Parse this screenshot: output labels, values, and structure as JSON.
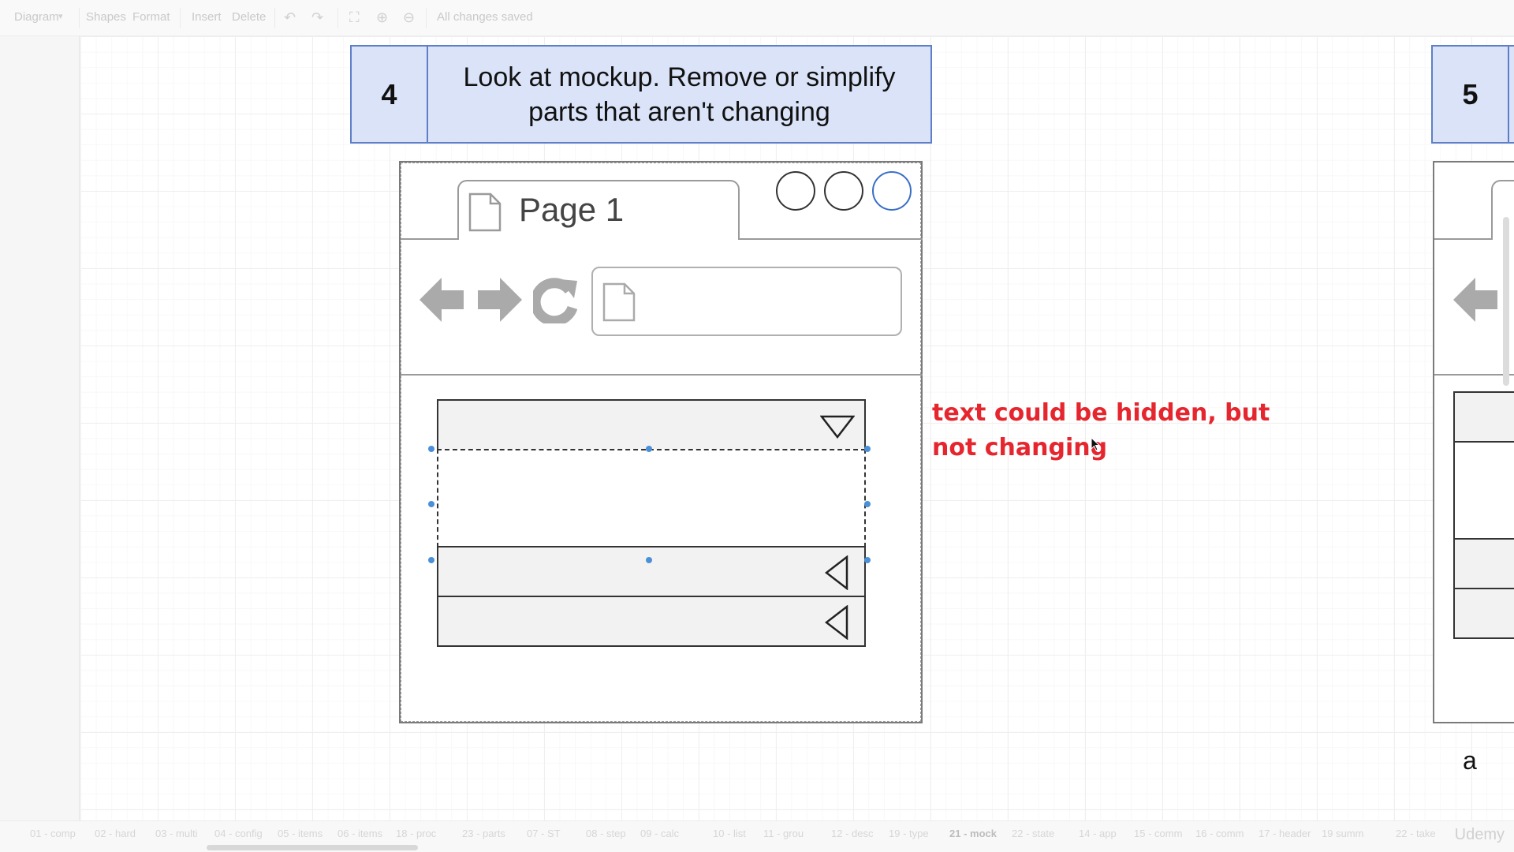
{
  "toolbar": {
    "diagram_menu": "Diagram",
    "shapes": "Shapes",
    "format": "Format",
    "insert": "Insert",
    "delete": "Delete",
    "undo_icon": "undo-icon",
    "redo_icon": "redo-icon",
    "fullscreen_icon": "fullscreen-icon",
    "zoom_in_icon": "zoom-in-icon",
    "zoom_out_icon": "zoom-out-icon",
    "status": "All changes saved"
  },
  "steps": [
    {
      "number": "4",
      "text_line1": "Look at mockup. Remove or simplify",
      "text_line2": "parts that aren't changing"
    },
    {
      "number": "5"
    }
  ],
  "mockup": {
    "tab_label": "Page 1",
    "accent_color": "#3a6ec5"
  },
  "note": {
    "line1": "text could be hidden, but",
    "line2": "not changing",
    "color": "#e6262e"
  },
  "stray_text": "a",
  "page_tabs": [
    {
      "label": "01 - comp",
      "active": false
    },
    {
      "label": "02 - hard",
      "active": false
    },
    {
      "label": "03 - multi",
      "active": false
    },
    {
      "label": "04 - config",
      "active": false
    },
    {
      "label": "05 - items",
      "active": false
    },
    {
      "label": "06 - items",
      "active": false
    },
    {
      "label": "18 - proc",
      "active": false
    },
    {
      "label": "23 - parts",
      "active": false
    },
    {
      "label": "07 - ST",
      "active": false
    },
    {
      "label": "08 - step",
      "active": false
    },
    {
      "label": "09 - calc",
      "active": false
    },
    {
      "label": "10 - list",
      "active": false
    },
    {
      "label": "11 - grou",
      "active": false
    },
    {
      "label": "12 - desc",
      "active": false
    },
    {
      "label": "19 - type",
      "active": false
    },
    {
      "label": "21 - mock",
      "active": true
    },
    {
      "label": "22 - state",
      "active": false
    },
    {
      "label": "14 - app",
      "active": false
    },
    {
      "label": "15 - comm",
      "active": false
    },
    {
      "label": "16 - comm",
      "active": false
    },
    {
      "label": "17 - header",
      "active": false
    },
    {
      "label": "19 summ",
      "active": false
    },
    {
      "label": "22 - take",
      "active": false
    }
  ],
  "watermark": "Udemy"
}
